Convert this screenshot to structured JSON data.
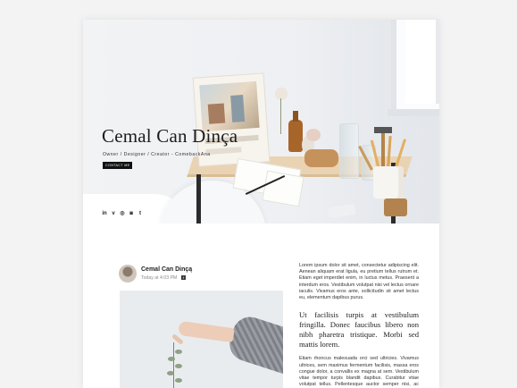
{
  "hero": {
    "title": "Cemal Can Dinça",
    "subtitle": "Owner / Designer / Creator - ComebackAna",
    "contact_button": "CONTACT ME",
    "socials": [
      {
        "icon": "linkedin-icon",
        "glyph": "in"
      },
      {
        "icon": "vimeo-icon",
        "glyph": "v"
      },
      {
        "icon": "whatsapp-icon",
        "glyph": "◎"
      },
      {
        "icon": "instagram-icon",
        "glyph": "◙"
      },
      {
        "icon": "tumblr-icon",
        "glyph": "t"
      }
    ]
  },
  "post": {
    "author": "Cemal Can Dinçą",
    "time": "Today at 4:03 PM",
    "source_icon": "facebook-icon",
    "paragraph1": "Lorem ipsum dolor sit amet, consectetur adipiscing elit. Aenean aliquam erat ligula, eu pretium tellus rutrum et. Etiam eget imperdiet enim, in luctus metus. Praesent a interdum eros. Vestibulum volutpat nisi vel lectus ornare iaculis. Vivamus eros ante, sollicitudin sit amet lectus eu, elementum dapibus purus.",
    "pullquote": "Ut facilisis turpis at vestibulum fringilla. Donec faucibus libero non nibh pharetra tristique. Morbi sed mattis lorem.",
    "paragraph2": "Etiam rhoncus malesuada orci sed ultricies. Vivamus ultrices, sem maximus fermentum facilisis, massa eros congue dolor, a convallis ex magna at sem. Vestibulum vitae tempor turpis blandit dapibus. Curabitur vitae volutpat tellus. Pellentesque auctor semper nisi, ac scelerisque nibh sem"
  }
}
